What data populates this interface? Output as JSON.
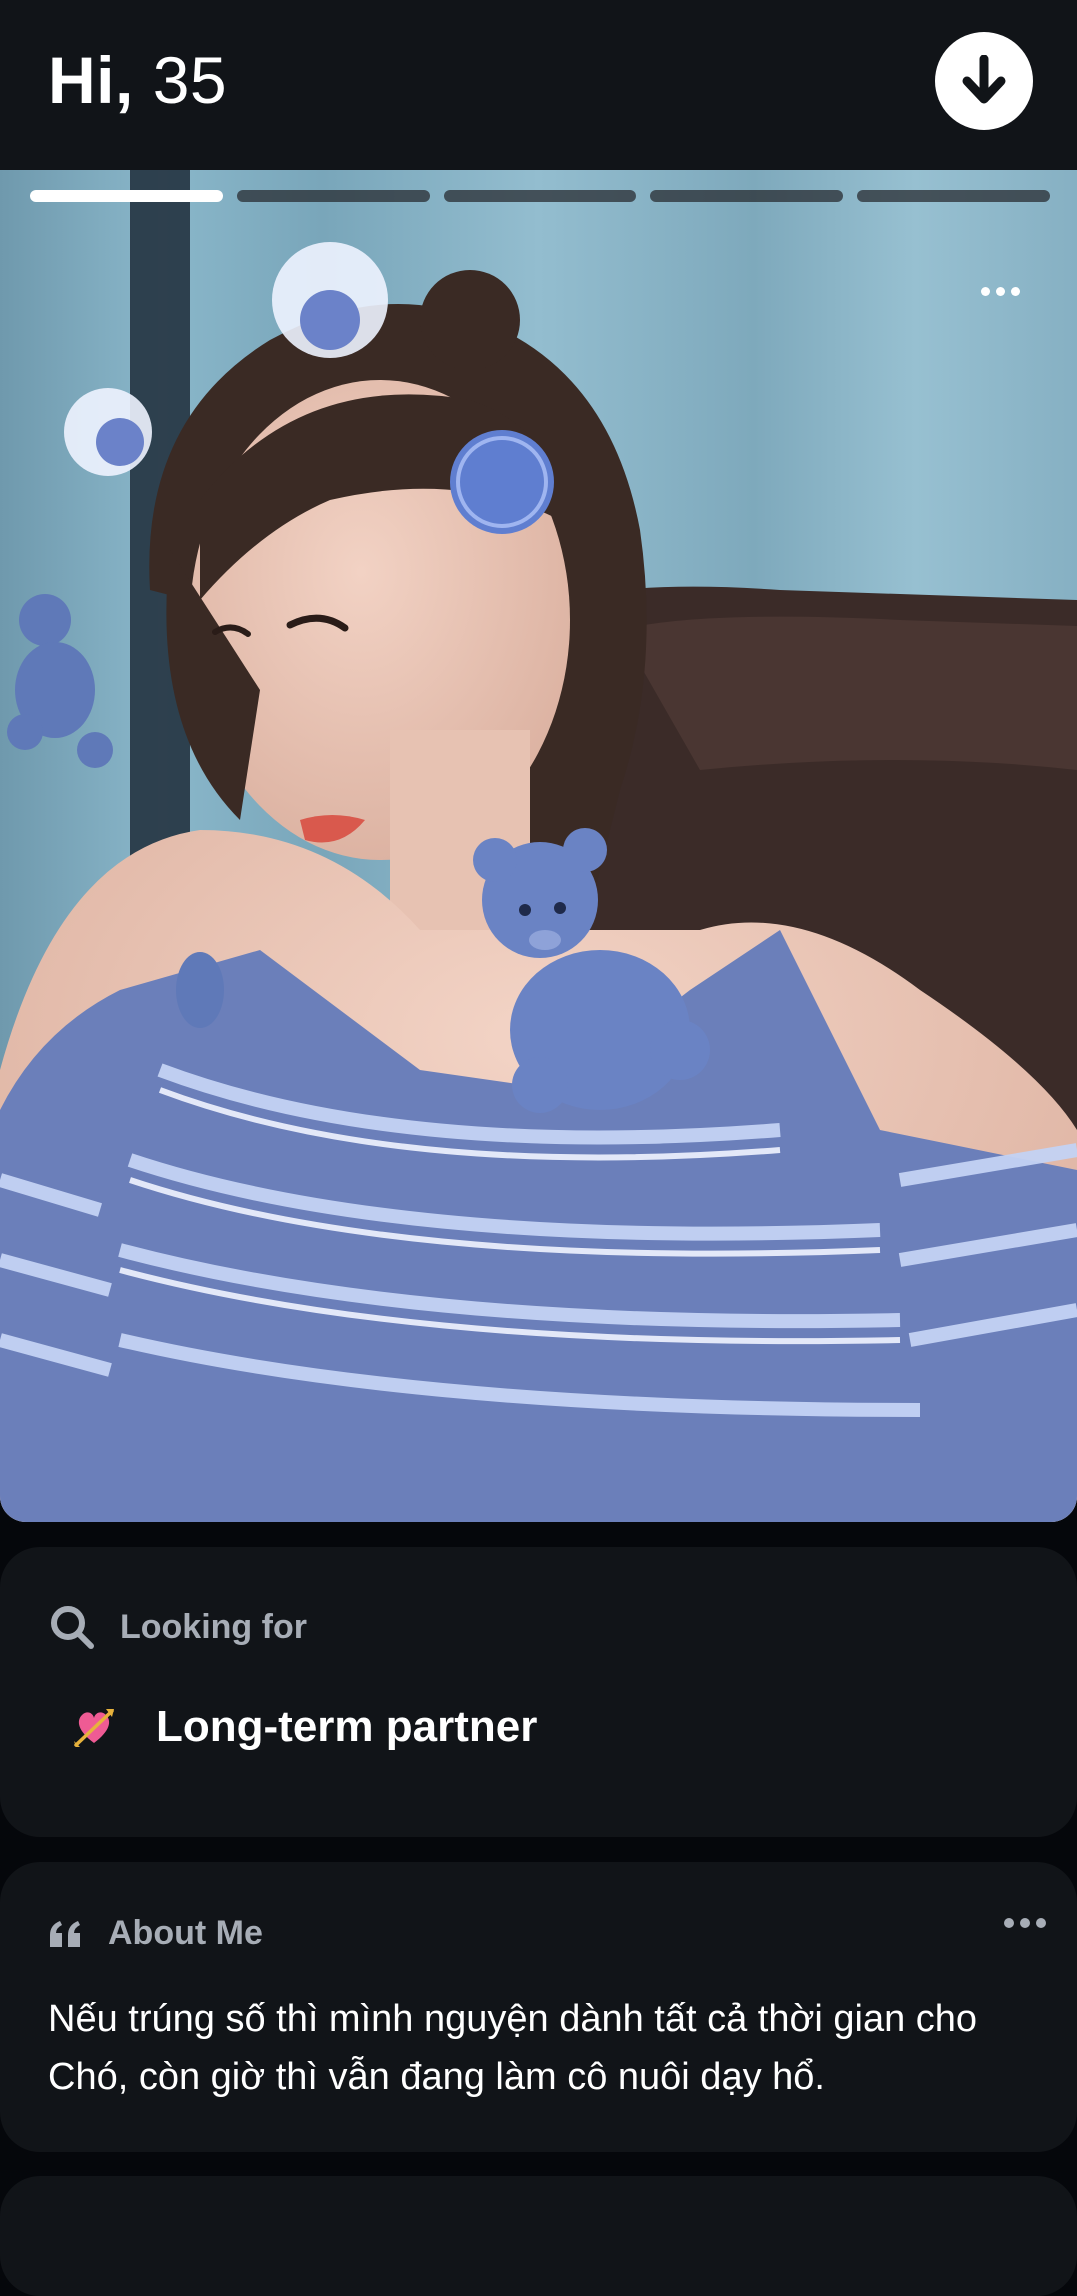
{
  "header": {
    "greeting": "Hi,",
    "name": "35",
    "download_icon": "arrow-down-icon"
  },
  "photo": {
    "photo_count": 5,
    "active_photo": 1,
    "more_icon": "more-horizontal-icon"
  },
  "looking_for": {
    "label": "Looking for",
    "icon": "search-icon",
    "emoji": "heart-with-arrow-icon",
    "value": "Long-term partner"
  },
  "about_me": {
    "label": "About Me",
    "icon": "quote-icon",
    "more_icon": "more-horizontal-icon",
    "text": "Nếu trúng số thì mình nguyện dành tất cả thời gian cho Chó, còn giờ thì vẫn đang làm cô nuôi dạy hổ."
  },
  "colors": {
    "background": "#05070b",
    "card": "#111418",
    "heading": "#a7adb6",
    "text": "#ffffff"
  }
}
